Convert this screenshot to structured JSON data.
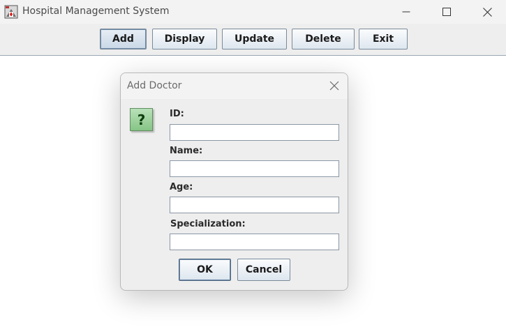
{
  "window": {
    "title": "Hospital Management System",
    "icon": "app-icon"
  },
  "toolbar": {
    "buttons": [
      {
        "label": "Add"
      },
      {
        "label": "Display"
      },
      {
        "label": "Update"
      },
      {
        "label": "Delete"
      },
      {
        "label": "Exit"
      }
    ]
  },
  "dialog": {
    "title": "Add Doctor",
    "icon_glyph": "?",
    "fields": [
      {
        "label": "ID:",
        "value": ""
      },
      {
        "label": "Name:",
        "value": ""
      },
      {
        "label": "Age:",
        "value": ""
      },
      {
        "label": "Specialization:",
        "value": ""
      }
    ],
    "ok_label": "OK",
    "cancel_label": "Cancel"
  }
}
